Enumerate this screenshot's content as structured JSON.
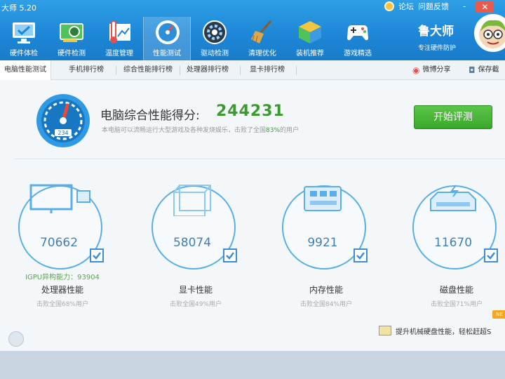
{
  "app": {
    "title": "大师 5.20",
    "links": [
      "论坛",
      "问题反馈"
    ],
    "window_buttons": [
      "-",
      "✕"
    ]
  },
  "nav": [
    {
      "label": "硬件体检",
      "icon": "monitor-check-icon"
    },
    {
      "label": "硬件检测",
      "icon": "graphics-card-icon"
    },
    {
      "label": "温度管理",
      "icon": "thermometer-icon"
    },
    {
      "label": "性能测试",
      "icon": "speedometer-icon",
      "active": true
    },
    {
      "label": "驱动检测",
      "icon": "driver-gear-icon"
    },
    {
      "label": "清理优化",
      "icon": "broom-icon"
    },
    {
      "label": "装机推荐",
      "icon": "cube-icon"
    },
    {
      "label": "游戏精选",
      "icon": "gamepad-icon"
    }
  ],
  "brand": {
    "name": "鲁大师",
    "slogan": "专注硬件防护"
  },
  "subtabs": [
    "电脑性能测试",
    "手机排行榜",
    "综合性能排行榜",
    "处理器排行榜",
    "显卡排行榜"
  ],
  "share": {
    "weibo": "微博分享",
    "save": "保存截"
  },
  "score": {
    "label": "电脑综合性能得分:",
    "value": "244231",
    "desc_prefix": "本电脑可以流畅运行大型游戏及各种发烧娱乐，击败了全国",
    "desc_percent": "83%",
    "desc_suffix": "的用户",
    "gauge_reading": "234",
    "start_label": "开始评测"
  },
  "cards": [
    {
      "score": "70662",
      "igpu": "IGPU异构能力：93904",
      "title": "处理器性能",
      "sub": "击败全国68%用户",
      "icon": "cpu-monitor-icon"
    },
    {
      "score": "58074",
      "title": "显卡性能",
      "sub": "击败全国49%用户",
      "icon": "gpu-cube-icon"
    },
    {
      "score": "9921",
      "title": "内存性能",
      "sub": "击败全国84%用户",
      "icon": "memory-chip-icon"
    },
    {
      "score": "11670",
      "title": "磁盘性能",
      "sub": "击败全国71%用户",
      "icon": "disk-drive-icon"
    }
  ],
  "bottom": {
    "promo": "提升机械硬盘性能，轻松赶超S",
    "badge": "NE"
  },
  "colors": {
    "header": "#1d86d6",
    "accent_green": "#3a9c2e",
    "ring_blue": "#5aaee5"
  }
}
